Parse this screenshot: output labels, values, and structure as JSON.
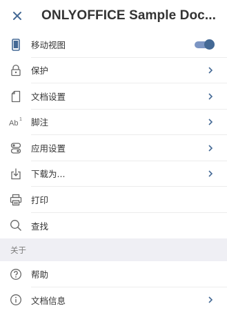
{
  "header": {
    "title": "ONLYOFFICE Sample Doc...",
    "close_icon": "close-icon"
  },
  "colors": {
    "accent": "#446995",
    "track": "#7b95c3",
    "section_bg": "#efeff4",
    "text": "#333333"
  },
  "menu": {
    "items": [
      {
        "label": "移动视图",
        "icon": "phone-icon",
        "control": "toggle",
        "toggle_on": true
      },
      {
        "label": "保护",
        "icon": "lock-icon",
        "control": "chevron"
      },
      {
        "label": "文档设置",
        "icon": "document-icon",
        "control": "chevron"
      },
      {
        "label": "脚注",
        "icon": "footnote-icon",
        "control": "chevron"
      },
      {
        "label": "应用设置",
        "icon": "app-settings-icon",
        "control": "chevron"
      },
      {
        "label": "下载为...",
        "icon": "download-icon",
        "control": "chevron"
      },
      {
        "label": "打印",
        "icon": "print-icon",
        "control": "none"
      },
      {
        "label": "查找",
        "icon": "search-icon",
        "control": "none"
      }
    ]
  },
  "about": {
    "section_label": "关于",
    "items": [
      {
        "label": "帮助",
        "icon": "help-icon",
        "control": "none"
      },
      {
        "label": "文档信息",
        "icon": "info-icon",
        "control": "chevron"
      }
    ]
  }
}
